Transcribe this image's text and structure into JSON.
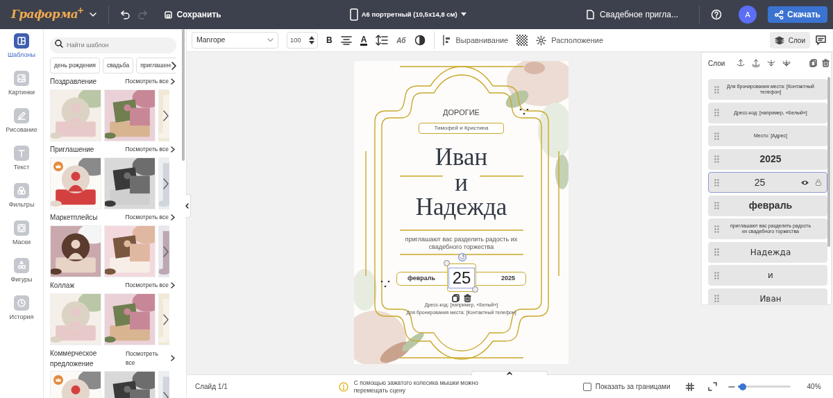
{
  "topbar": {
    "logo": "Граформа",
    "save": "Сохранить",
    "format": "А6 портретный (10,5x14,8 см)",
    "document": "Свадебное пригла...",
    "avatar": "А",
    "download": "Скачать",
    "redo_disabled": true
  },
  "rail": [
    {
      "label": "Шаблоны",
      "selected": true
    },
    {
      "label": "Картинки",
      "selected": false
    },
    {
      "label": "Рисование",
      "selected": false
    },
    {
      "label": "Текст",
      "selected": false
    },
    {
      "label": "Фильтры",
      "selected": false
    },
    {
      "label": "Маски",
      "selected": false
    },
    {
      "label": "Фигуры",
      "selected": false
    },
    {
      "label": "История",
      "selected": false
    }
  ],
  "templates": {
    "search": {
      "placeholder": "Найти шаблон"
    },
    "chips": [
      "день рождения",
      "свадьба",
      "приглашени"
    ],
    "sections": [
      {
        "title": "Поздравление",
        "link": "Посмотреть все",
        "thumbs": [
          {
            "kind": "picture",
            "premium": false
          },
          {
            "kind": "picture",
            "premium": false
          },
          {
            "kind": "picture",
            "premium": false
          }
        ]
      },
      {
        "title": "Приглашение",
        "link": "Посмотреть все",
        "thumbs": [
          {
            "kind": "picture",
            "premium": true
          },
          {
            "kind": "picture",
            "premium": false
          },
          {
            "kind": "picture",
            "premium": false
          }
        ]
      },
      {
        "title": "Маркетплейсы",
        "link": "Посмотреть все",
        "thumbs": [
          {
            "kind": "picture",
            "premium": false
          },
          {
            "kind": "picture",
            "premium": false
          },
          {
            "kind": "picture",
            "premium": false
          }
        ]
      },
      {
        "title": "Коллаж",
        "link": "Посмотреть все",
        "thumbs": [
          {
            "kind": "picture",
            "premium": false
          },
          {
            "kind": "picture",
            "premium": false
          },
          {
            "kind": "picture",
            "premium": false
          }
        ]
      },
      {
        "title": "Коммерческое предложение",
        "link": "Посмотреть все",
        "thumbs": [
          {
            "kind": "picture",
            "premium": true
          },
          {
            "kind": "picture",
            "premium": false
          },
          {
            "kind": "picture",
            "premium": false
          }
        ]
      }
    ]
  },
  "toolbar": {
    "font": "Manrope",
    "size": "100",
    "bold_glyph": "B",
    "color_glyph": "A",
    "effects_glyph": "Аб",
    "align": "Выравнивание",
    "arrange": "Расположение",
    "layers_button": {
      "label": "Слои",
      "selected": true
    }
  },
  "card": {
    "dear": "ДОРОГИЕ",
    "guests": "Тимофей и Кристина",
    "groom": "Иван",
    "and": "и",
    "bride": "Надежда",
    "invite": "приглашают вас разделить радость их свадебного торжества",
    "month": "февраль",
    "day": "25",
    "year": "2025",
    "dress": "Дресс-код: [например, «Белый»]",
    "booking": "Для бронирования места: [Контактный телефон]"
  },
  "layers": {
    "title": "Слои",
    "items": [
      {
        "text": "Для бронирования места: [Контактный телефон]",
        "kind": "tiny",
        "selected": false
      },
      {
        "text": "Дресс-код: [например, «Белый»]",
        "kind": "tiny",
        "selected": false
      },
      {
        "text": "Место: [Адрес]",
        "kind": "tiny",
        "selected": false
      },
      {
        "text": "2025",
        "kind": "bold",
        "selected": false
      },
      {
        "text": "25",
        "kind": "plain",
        "selected": true
      },
      {
        "text": "февраль",
        "kind": "bold",
        "selected": false
      },
      {
        "text": "приглашают вас разделить радость их свадебного торжества",
        "kind": "small",
        "selected": false
      },
      {
        "text": "Надежда",
        "kind": "serif",
        "selected": false
      },
      {
        "text": "и",
        "kind": "serif",
        "selected": false
      },
      {
        "text": "Иван",
        "kind": "serif",
        "selected": false
      }
    ]
  },
  "bottom": {
    "slide": "Слайд 1/1",
    "hint": "С помощью зажатого колесика мышки можно перемещать сцену",
    "show_outside": {
      "label": "Показать за границами",
      "checked": false
    },
    "zoom": {
      "level": 0.1,
      "reading": "40%"
    }
  }
}
